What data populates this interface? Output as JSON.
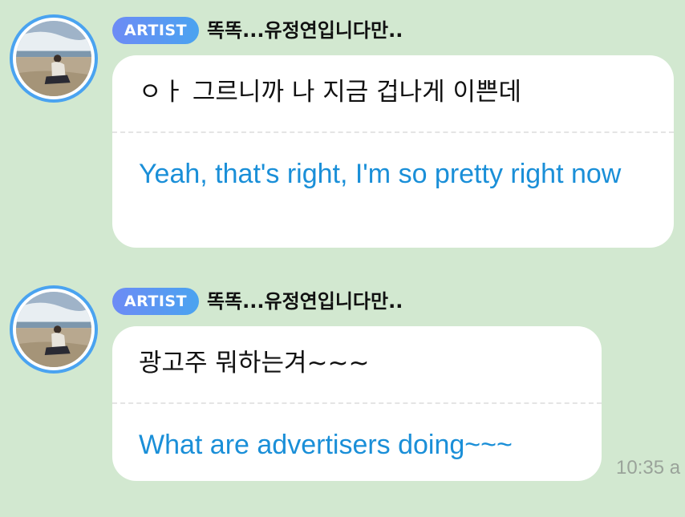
{
  "messages": [
    {
      "badge": "ARTIST",
      "sender": "똑똑...유정연입니다만..",
      "original": "ㅇㅏ 그르니까 나 지금 겁나게 이쁜데",
      "translation": "Yeah, that's right, I'm so pretty right now",
      "time": ""
    },
    {
      "badge": "ARTIST",
      "sender": "똑똑...유정연입니다만..",
      "original": "광고주 뭐하는겨~~~",
      "translation": "What are advertisers doing~~~",
      "time": "10:35 a"
    }
  ],
  "colors": {
    "background": "#d2e8d0",
    "avatar_ring": "#4aa3f0",
    "badge_start": "#6d8bf5",
    "badge_end": "#4aa3f0",
    "translation_text": "#1a8fd8",
    "timestamp": "#9aa39a"
  },
  "icons": {
    "avatar": "profile-photo-person-sitting-on-beach"
  }
}
